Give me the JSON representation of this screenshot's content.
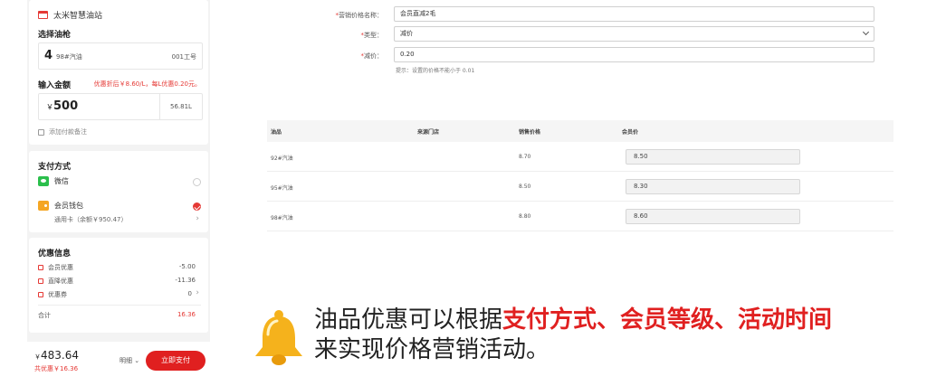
{
  "left": {
    "station": "太米智慧油站",
    "select_gun_title": "选择油枪",
    "gun": {
      "number": "4",
      "fuel": "98#汽油",
      "gun_id": "001工号"
    },
    "amount_title": "输入金额",
    "promo_note": "优惠折后￥8.60/L，每L优惠0.20元。",
    "amount_currency": "￥",
    "amount_value": "500",
    "liters": "56.81L",
    "remark": "添加付款备注",
    "pay_title": "支付方式",
    "pay_options": [
      {
        "label": "微信",
        "icon": "wechat-icon",
        "selected": false
      },
      {
        "label": "会员钱包",
        "icon": "wallet-icon",
        "selected": true,
        "note": "通用卡（余额￥950.47）"
      }
    ],
    "discount_title": "优惠信息",
    "discounts": [
      {
        "label": "会员优惠",
        "value": "-5.00"
      },
      {
        "label": "直降优惠",
        "value": "-11.36"
      },
      {
        "label": "优惠券",
        "value": "0"
      }
    ],
    "total_label": "合计",
    "total_value": "16.36",
    "bottom": {
      "currency": "￥",
      "amount": "483.64",
      "saved": "共优惠￥16.36",
      "detail": "明细",
      "pay_button": "立即支付"
    }
  },
  "form": {
    "name_label": "营销价格名称：",
    "name_value": "会员直减2毛",
    "type_label": "类型：",
    "type_value": "减价",
    "reduce_label": "减价：",
    "reduce_value": "0.20",
    "hint": "提示：设置的价格不能小于 0.01"
  },
  "table": {
    "headers": [
      "油品",
      "来源门店",
      "销售价格",
      "会员价"
    ],
    "rows": [
      {
        "fuel": "92#汽油",
        "price": "8.70",
        "member_price": "8.50"
      },
      {
        "fuel": "95#汽油",
        "price": "8.50",
        "member_price": "8.30"
      },
      {
        "fuel": "98#汽油",
        "price": "8.80",
        "member_price": "8.60"
      }
    ]
  },
  "banner": {
    "line1_prefix": "油品优惠可以根据",
    "line1_highlight": "支付方式、会员等级、活动时间",
    "line2": "来实现价格营销活动。"
  },
  "colors": {
    "accent": "#e02020",
    "wechat": "#2bbf4c",
    "wallet": "#f5a623",
    "bell": "#f5b21c"
  }
}
